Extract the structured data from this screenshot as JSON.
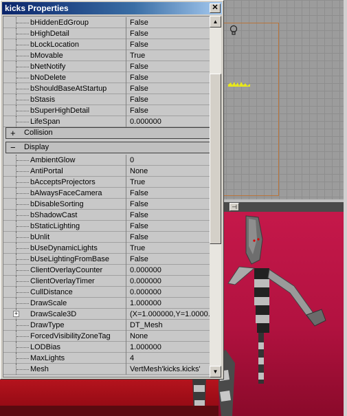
{
  "window": {
    "title": "kicks Properties",
    "close_label": "✕"
  },
  "rows_top": [
    {
      "name": "bHiddenEdGroup",
      "value": "False"
    },
    {
      "name": "bHighDetail",
      "value": "False"
    },
    {
      "name": "bLockLocation",
      "value": "False"
    },
    {
      "name": "bMovable",
      "value": "True"
    },
    {
      "name": "bNetNotify",
      "value": "False"
    },
    {
      "name": "bNoDelete",
      "value": "False"
    },
    {
      "name": "bShouldBaseAtStartup",
      "value": "False"
    },
    {
      "name": "bStasis",
      "value": "False"
    },
    {
      "name": "bSuperHighDetail",
      "value": "False"
    },
    {
      "name": "LifeSpan",
      "value": "0.000000"
    }
  ],
  "categories": [
    {
      "sign": "+",
      "label": "Collision"
    },
    {
      "sign": "−",
      "label": "Display"
    }
  ],
  "rows_display": [
    {
      "name": "AmbientGlow",
      "value": "0"
    },
    {
      "name": "AntiPortal",
      "value": "None"
    },
    {
      "name": "bAcceptsProjectors",
      "value": "True"
    },
    {
      "name": "bAlwaysFaceCamera",
      "value": "False"
    },
    {
      "name": "bDisableSorting",
      "value": "False"
    },
    {
      "name": "bShadowCast",
      "value": "False"
    },
    {
      "name": "bStaticLighting",
      "value": "False"
    },
    {
      "name": "bUnlit",
      "value": "False"
    },
    {
      "name": "bUseDynamicLights",
      "value": "True"
    },
    {
      "name": "bUseLightingFromBase",
      "value": "False"
    },
    {
      "name": "ClientOverlayCounter",
      "value": "0.000000"
    },
    {
      "name": "ClientOverlayTimer",
      "value": "0.000000"
    },
    {
      "name": "CullDistance",
      "value": "0.000000"
    },
    {
      "name": "DrawScale",
      "value": "1.000000"
    },
    {
      "name": "DrawScale3D",
      "value": "(X=1.000000,Y=1.0000...",
      "expandable": true
    },
    {
      "name": "DrawType",
      "value": "DT_Mesh"
    },
    {
      "name": "ForcedVisibilityZoneTag",
      "value": "None"
    },
    {
      "name": "LODBias",
      "value": "1.000000"
    },
    {
      "name": "MaxLights",
      "value": "4"
    },
    {
      "name": "Mesh",
      "value": "VertMesh'kicks.kicks'"
    }
  ],
  "scrollbar": {
    "up": "▲",
    "down": "▼"
  },
  "viewport": {
    "pin_label": "⊣"
  },
  "colors": {
    "titlebar": "#0a246a",
    "window_bg": "#d4d0c8",
    "grid_bg": "#c8c8c8",
    "viewport_red": "#c5184a"
  }
}
